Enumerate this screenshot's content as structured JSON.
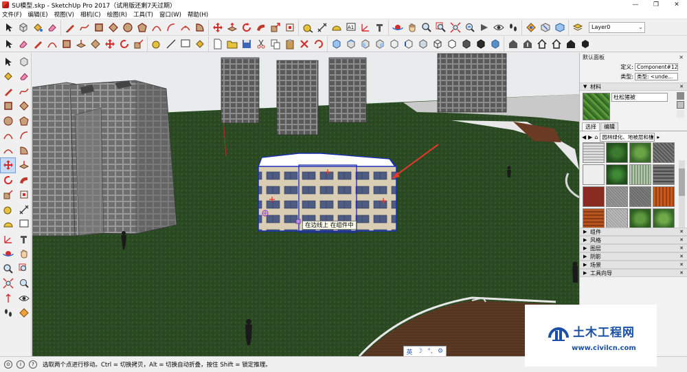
{
  "window": {
    "title": "SU模型.skp - SketchUp Pro 2017（试用版还剩7天过期）",
    "minimize": "—",
    "maximize": "❐",
    "close": "✕"
  },
  "menu": [
    "文件(F)",
    "编辑(E)",
    "视图(V)",
    "相机(C)",
    "绘图(R)",
    "工具(T)",
    "窗口(W)",
    "帮助(H)"
  ],
  "toolbar": {
    "layer_value": "Layer0",
    "layer_chevron": "⌄",
    "dimension_text_tool": "A1"
  },
  "viewport": {
    "tooltip": "在边线上  在组件中",
    "ime": {
      "lang": "英",
      "moon": "☽",
      "punct": "°,",
      "gear": "⚙"
    }
  },
  "tray": {
    "title": "默认面板",
    "close": "✕",
    "entity_info": {
      "def_label": "定义:",
      "def_value": "Component#12",
      "type_label": "类型:",
      "type_value": "类型: <unde..."
    },
    "materials": {
      "header": "材料",
      "current_name": "杜松猪被",
      "tabs": [
        "选择",
        "编辑"
      ],
      "collection": "园林绿化、地被层和植被"
    },
    "panels": [
      "组件",
      "风格",
      "图层",
      "阴影",
      "场景",
      "工具向导"
    ]
  },
  "status": {
    "text": "选取两个点进行移动。Ctrl = 切换拷贝，Alt = 切换自动折叠，按住 Shift = 锁定推理。"
  },
  "watermark": {
    "name": "土木工程网",
    "url": "www.civilcn.com"
  },
  "colors": {
    "grass": "#2a4b22",
    "sky": "#e8ecec",
    "selection": "#1a2fb0",
    "accent_red": "#e8382b",
    "watermark_blue": "#1a4fa5"
  }
}
